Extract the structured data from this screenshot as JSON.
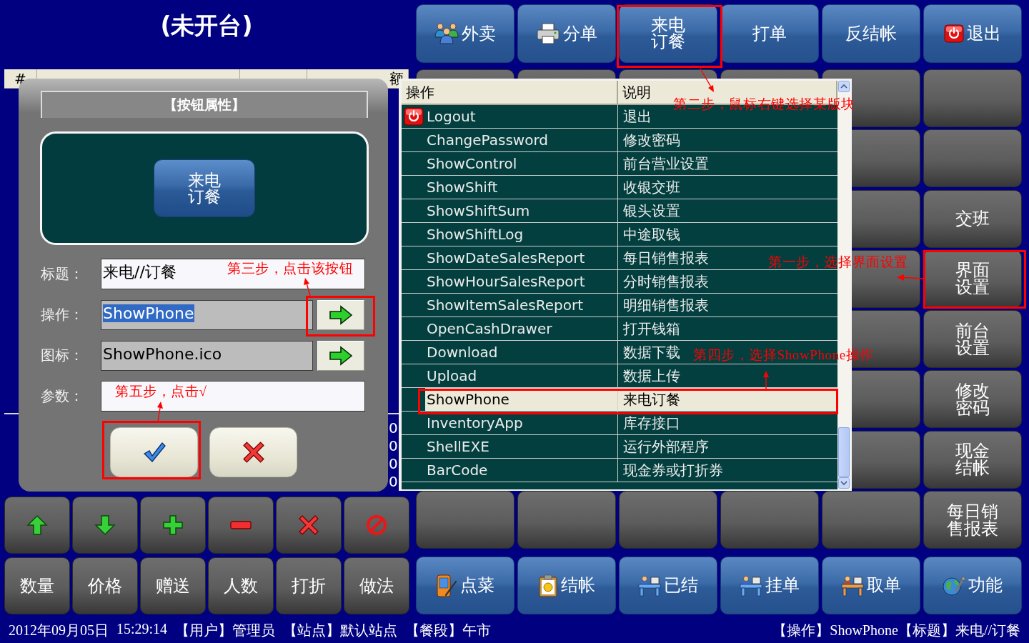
{
  "table_status": {
    "title": "(未开台)"
  },
  "order_table": {
    "column_1": "#",
    "column_4": "额",
    "summary_values": [
      "0",
      "0",
      "0",
      "0"
    ]
  },
  "top_buttons": [
    "外卖",
    "分单",
    "来电订餐",
    "打单",
    "反结帐",
    "退出"
  ],
  "side_buttons": [
    "交班",
    "界面设置",
    "前台设置",
    "修改密码",
    "现金结帐",
    "每日销售报表"
  ],
  "left_buttons": [
    "数量",
    "价格",
    "赠送",
    "人数",
    "打折",
    "做法"
  ],
  "bottom_buttons": [
    "点菜",
    "结帐",
    "已结",
    "挂单",
    "取单",
    "功能"
  ],
  "dialog": {
    "title": "【按钮属性】",
    "preview_button": "来电订餐",
    "fields": [
      {
        "label": "标题：",
        "kind": "text",
        "value": "来电//订餐",
        "value_selected": false
      },
      {
        "label": "操作：",
        "kind": "picker",
        "value": "ShowPhone",
        "value_selected": true
      },
      {
        "label": "图标：",
        "kind": "picker",
        "value": "ShowPhone.ico",
        "value_selected": false
      },
      {
        "label": "参数：",
        "kind": "text"
      }
    ]
  },
  "action_list": {
    "columns": [
      "操作",
      "说明"
    ],
    "rows": [
      {
        "name": "Logout",
        "description": "退出",
        "icon": true,
        "selected": false
      },
      {
        "name": "ChangePassword",
        "description": "修改密码",
        "icon": false,
        "selected": false
      },
      {
        "name": "ShowControl",
        "description": "前台营业设置",
        "icon": false,
        "selected": false
      },
      {
        "name": "ShowShift",
        "description": "收银交班",
        "icon": false,
        "selected": false
      },
      {
        "name": "ShowShiftSum",
        "description": "银头设置",
        "icon": false,
        "selected": false
      },
      {
        "name": "ShowShiftLog",
        "description": "中途取钱",
        "icon": false,
        "selected": false
      },
      {
        "name": "ShowDateSalesReport",
        "description": "每日销售报表",
        "icon": false,
        "selected": false
      },
      {
        "name": "ShowHourSalesReport",
        "description": "分时销售报表",
        "icon": false,
        "selected": false
      },
      {
        "name": "ShowItemSalesReport",
        "description": "明细销售报表",
        "icon": false,
        "selected": false
      },
      {
        "name": "OpenCashDrawer",
        "description": "打开钱箱",
        "icon": false,
        "selected": false
      },
      {
        "name": "Download",
        "description": "数据下载",
        "icon": false,
        "selected": false
      },
      {
        "name": "Upload",
        "description": "数据上传",
        "icon": false,
        "selected": false
      },
      {
        "name": "ShowPhone",
        "description": "来电订餐",
        "icon": false,
        "selected": true
      },
      {
        "name": "InventoryApp",
        "description": "库存接口",
        "icon": false,
        "selected": false
      },
      {
        "name": "ShellEXE",
        "description": "运行外部程序",
        "icon": false,
        "selected": false
      },
      {
        "name": "BarCode",
        "description": "现金券或打折券",
        "icon": false,
        "selected": false
      }
    ]
  },
  "status_bar": {
    "left": [
      "2012年09月05日",
      "15:29:14",
      "【用户】管理员",
      "【站点】默认站点",
      "【餐段】午市"
    ],
    "right": [
      "【操作】ShowPhone",
      "【标题】来电//订餐"
    ]
  },
  "annotations": [
    "第一步，选择界面设置",
    "第二步，鼠标右键选择某版块",
    "第三步，点击该按钮",
    "第四步，选择ShowPhone操作",
    "第五步，点击√"
  ]
}
